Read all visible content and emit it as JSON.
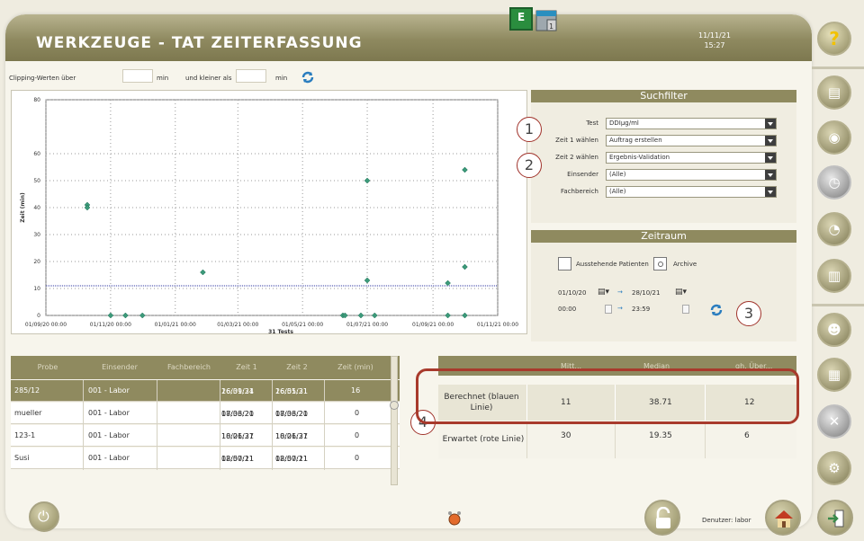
{
  "header": {
    "title": "WERKZEUGE - TAT ZEITERFASSUNG",
    "date": "11/11/21",
    "time": "15:27",
    "top_icons": [
      "e-icon",
      "database-icon"
    ]
  },
  "clipping": {
    "label_over": "Clipping-Werten über",
    "unit1": "min",
    "label_less": "und kleiner als",
    "unit2": "min",
    "value1": "",
    "value2": ""
  },
  "chart_data": {
    "type": "scatter",
    "ylabel": "Zeit (min)",
    "xlabel": "31 Tests",
    "ylim": [
      0,
      80
    ],
    "yticks": [
      "0",
      "10",
      "20",
      "30",
      "40",
      "50",
      "60",
      "80"
    ],
    "xticks": [
      "01/09/20 00:00",
      "01/11/20 00:00",
      "01/01/21 00:00",
      "01/03/21 00:00",
      "01/05/21 00:00",
      "01/07/21 00:00",
      "01/09/21 00:00",
      "01/11/21 00:00"
    ],
    "x_range": [
      "01/09/20 00:00",
      "01/11/21 00:00"
    ],
    "mean_line": 11,
    "points": [
      {
        "x": "10/10/20",
        "y": 41
      },
      {
        "x": "10/10/20",
        "y": 40
      },
      {
        "x": "27/01/21",
        "y": 16
      },
      {
        "x": "01/07/21",
        "y": 50
      },
      {
        "x": "01/07/21",
        "y": 13
      },
      {
        "x": "15/09/21",
        "y": 12
      },
      {
        "x": "01/10/21",
        "y": 18
      },
      {
        "x": "01/10/21",
        "y": 54
      },
      {
        "x": "01/11/20",
        "y": 0
      },
      {
        "x": "15/11/20",
        "y": 0
      },
      {
        "x": "01/12/20",
        "y": 0
      },
      {
        "x": "08/06/21",
        "y": 0
      },
      {
        "x": "10/06/21",
        "y": 0
      },
      {
        "x": "25/06/21",
        "y": 0
      },
      {
        "x": "08/07/21",
        "y": 0
      },
      {
        "x": "15/09/21",
        "y": 0
      },
      {
        "x": "01/10/21",
        "y": 0
      }
    ],
    "grid": true,
    "series_colors": {
      "points": "#3c9a7a",
      "line": "#2e34a0"
    }
  },
  "filter": {
    "title": "Suchfilter",
    "rows": [
      {
        "label": "Test",
        "value": "DDIμg/ml"
      },
      {
        "label": "Zeit 1 wählen",
        "value": "Auftrag erstellen"
      },
      {
        "label": "Zeit 2 wählen",
        "value": "Ergebnis-Validation"
      },
      {
        "label": "Einsender",
        "value": "(Alle)"
      },
      {
        "label": "Fachbereich",
        "value": "(Alle)"
      }
    ]
  },
  "zeitraum": {
    "title": "Zeitraum",
    "pending_label": "Ausstehende Patienten",
    "archive_label": "Archive",
    "date_from": "01/10/20",
    "date_to": "28/10/21",
    "time_from": "00:00",
    "time_to": "23:59",
    "arrow": "→"
  },
  "annotations": [
    "1",
    "2",
    "3",
    "4"
  ],
  "table": {
    "headers": [
      "Probe",
      "Einsender",
      "Fachbereich",
      "Zeit 1",
      "Zeit 2",
      "Zeit (min)"
    ],
    "rows": [
      {
        "probe": "285/12",
        "einsender": "001 - Labor",
        "fach": "",
        "z1a": "26/01/21",
        "z1b": "16:39:34",
        "z2a": "26/01/21",
        "z2b": "16:55:31",
        "min": "16"
      },
      {
        "probe": "mueller",
        "einsender": "001 - Labor",
        "fach": "",
        "z1a": "08/06/21",
        "z1b": "17:33:20",
        "z2a": "08/06/21",
        "z2b": "17:33:20",
        "min": "0"
      },
      {
        "probe": "123-1",
        "einsender": "001 - Labor",
        "fach": "",
        "z1a": "10/06/21",
        "z1b": "18:21:37",
        "z2a": "10/06/21",
        "z2b": "18:21:37",
        "min": "0"
      },
      {
        "probe": "Susi",
        "einsender": "001 - Labor",
        "fach": "",
        "z1a": "08/07/21",
        "z1b": "12:50:11",
        "z2a": "08/07/21",
        "z2b": "12:50:11",
        "min": "0"
      }
    ]
  },
  "stats": {
    "headers": [
      "",
      "Mitt...",
      "Median",
      "gh. Über..."
    ],
    "rows": [
      {
        "label": "Berechnet (blauen Linie)",
        "v1": "11",
        "v2": "38.71",
        "v3": "12"
      },
      {
        "label": "Erwartet (rote Linie)",
        "v1": "30",
        "v2": "19.35",
        "v3": "6"
      }
    ]
  },
  "footer": {
    "user_label": "Denutzer: labor"
  },
  "sidebar": {
    "buttons": [
      "help-icon",
      "print-icon",
      "disc-icon",
      "clock-icon",
      "alarm-icon",
      "documents-icon",
      "profile-icon",
      "chart-icon",
      "tools-icon",
      "settings-icon"
    ]
  }
}
